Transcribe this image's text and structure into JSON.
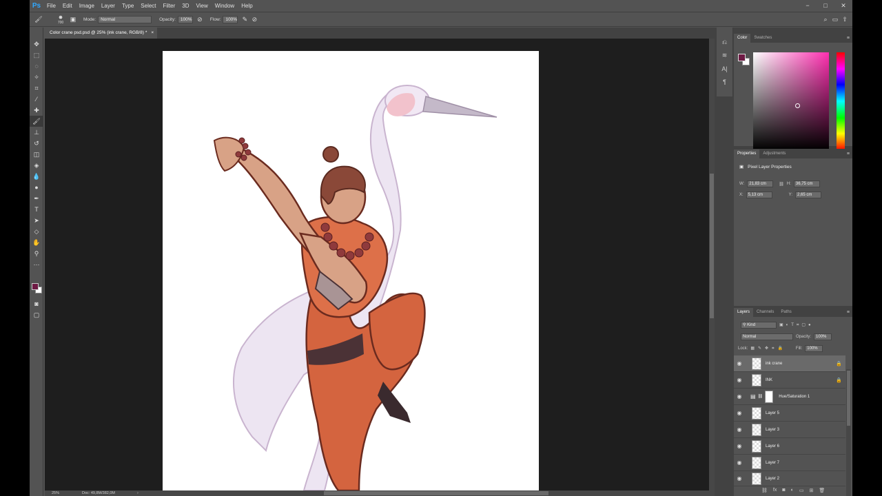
{
  "app": {
    "logo": "Ps"
  },
  "menu": [
    "File",
    "Edit",
    "Image",
    "Layer",
    "Type",
    "Select",
    "Filter",
    "3D",
    "View",
    "Window",
    "Help"
  ],
  "window_controls": [
    "−",
    "□",
    "✕"
  ],
  "options_bar": {
    "brush_size": "700",
    "mode_label": "Mode:",
    "mode_value": "Normal",
    "opacity_label": "Opacity:",
    "opacity_value": "100%",
    "flow_label": "Flow:",
    "flow_value": "100%"
  },
  "document_tab": {
    "title": "Color crane psd.psd @ 25% (ink crane, RGB/8) *",
    "close": "×"
  },
  "status_bar": {
    "zoom": "25%",
    "doc": "Doc: 49,8M/382,0M",
    "arrow": "›"
  },
  "color_panel": {
    "tabs": [
      "Color",
      "Swatches"
    ],
    "foreground": "#6e1a44",
    "background": "#ffffff"
  },
  "properties_panel": {
    "tabs": [
      "Properties",
      "Adjustments"
    ],
    "heading": "Pixel Layer Properties",
    "w_label": "W:",
    "w_value": "21,83 cm",
    "h_label": "H:",
    "h_value": "36,75 cm",
    "x_label": "X:",
    "x_value": "5,13 cm",
    "y_label": "Y:",
    "y_value": "2,65 cm"
  },
  "layers_panel": {
    "tabs": [
      "Layers",
      "Channels",
      "Paths"
    ],
    "filter_kind": "Kind",
    "blend_mode": "Normal",
    "opacity_label": "Opacity:",
    "opacity_value": "100%",
    "lock_label": "Lock:",
    "fill_label": "Fill:",
    "fill_value": "100%",
    "layers": [
      {
        "name": "ink crane",
        "selected": true,
        "locked": true
      },
      {
        "name": "INK",
        "selected": false,
        "locked": true
      },
      {
        "name": "Hue/Saturation 1",
        "selected": false,
        "locked": false
      },
      {
        "name": "Layer 5",
        "selected": false,
        "locked": false
      },
      {
        "name": "Layer 3",
        "selected": false,
        "locked": false
      },
      {
        "name": "Layer 6",
        "selected": false,
        "locked": false
      },
      {
        "name": "Layer 7",
        "selected": false,
        "locked": false
      },
      {
        "name": "Layer 2",
        "selected": false,
        "locked": false
      }
    ]
  }
}
